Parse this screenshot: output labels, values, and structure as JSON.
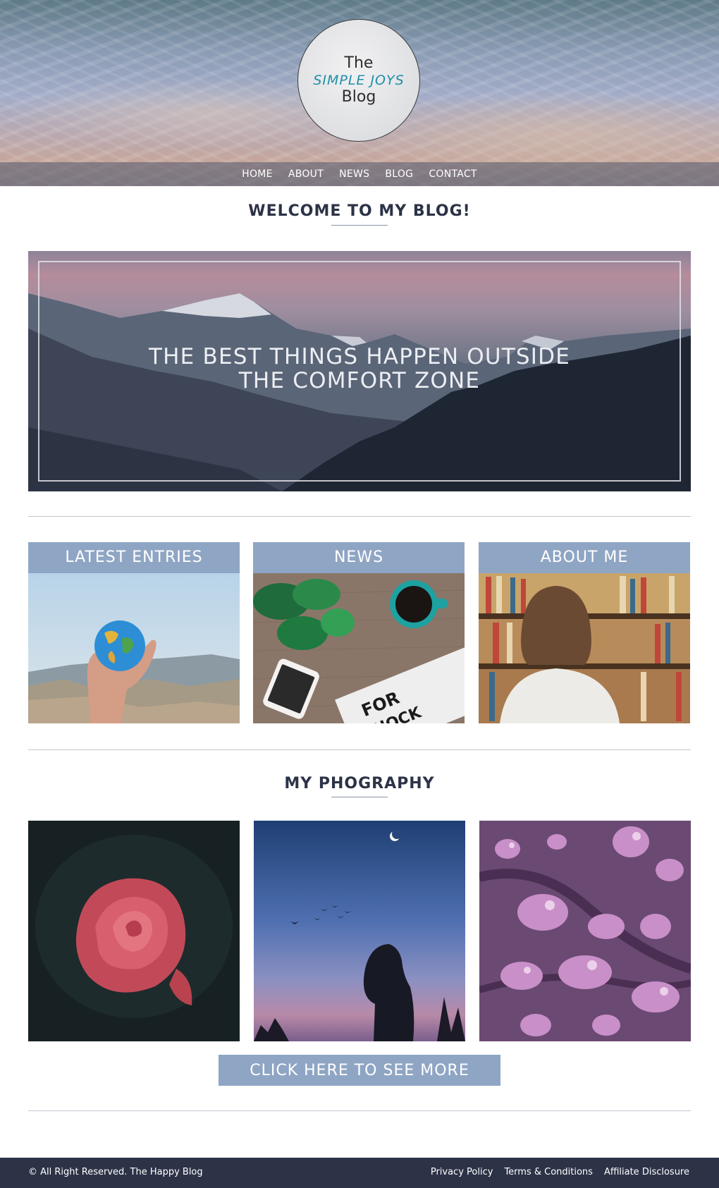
{
  "logo": {
    "line1": "The",
    "line2": "SIMPLE JOYS",
    "line3": "Blog"
  },
  "nav": {
    "items": [
      "HOME",
      "ABOUT",
      "NEWS",
      "BLOG",
      "CONTACT"
    ]
  },
  "welcome": {
    "title": "WELCOME TO MY BLOG!"
  },
  "hero": {
    "line1": "THE BEST THINGS HAPPEN OUTSIDE",
    "line2": "THE COMFORT ZONE"
  },
  "cards": [
    {
      "title": "LATEST ENTRIES",
      "image": "hand-holding-globe"
    },
    {
      "title": "NEWS",
      "image": "desk-with-plant-coffee-phone-newspaper"
    },
    {
      "title": "ABOUT ME",
      "image": "woman-in-front-of-bookshelf"
    }
  ],
  "photography": {
    "title": "MY PHOGRAPHY",
    "photos": [
      "red-rose-with-dew",
      "silhouette-under-moon-and-birds",
      "water-drops-on-purple-leaf"
    ],
    "cta_label": "CLICK HERE TO SEE MORE"
  },
  "footer": {
    "copyright": "© All Right Reserved. The Happy Blog",
    "links": [
      "Privacy Policy",
      "Terms & Conditions",
      "Affiliate Disclosure"
    ]
  },
  "colors": {
    "accent": "#8fa5c4",
    "footer_bg": "#2c3347",
    "logo_teal": "#1f8fa8"
  }
}
